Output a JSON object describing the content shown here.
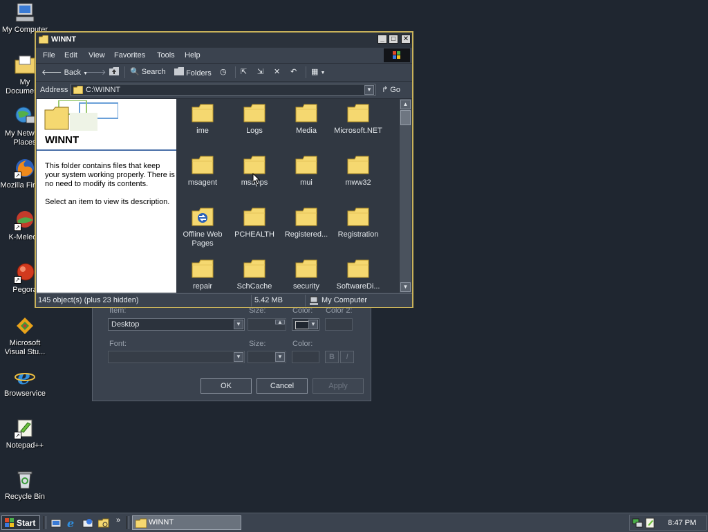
{
  "desktop": {
    "icons": [
      {
        "label": "My Computer",
        "icon": "my-computer-icon"
      },
      {
        "label": "My Documents",
        "icon": "my-documents-icon"
      },
      {
        "label": "My Network Places",
        "icon": "network-places-icon"
      },
      {
        "label": "Mozilla Firefox",
        "icon": "firefox-icon"
      },
      {
        "label": "K-Meleon",
        "icon": "kmeleon-icon"
      },
      {
        "label": "Pegora",
        "icon": "pegora-icon"
      },
      {
        "label": "Microsoft Visual Stu...",
        "icon": "visual-studio-icon"
      },
      {
        "label": "Browservice",
        "icon": "browservice-icon"
      },
      {
        "label": "Notepad++",
        "icon": "notepadpp-icon"
      },
      {
        "label": "Recycle Bin",
        "icon": "recycle-bin-icon"
      }
    ]
  },
  "background_dialog": {
    "item_label": "Item:",
    "item_value": "Desktop",
    "size_label": "Size:",
    "color_label": "Color:",
    "color2_label": "Color 2:",
    "font_label": "Font:",
    "font_size_label": "Size:",
    "font_color_label": "Color:",
    "bold_label": "B",
    "italic_label": "I",
    "ok_label": "OK",
    "cancel_label": "Cancel",
    "apply_label": "Apply"
  },
  "window": {
    "title": "WINNT",
    "menu": [
      "File",
      "Edit",
      "View",
      "Favorites",
      "Tools",
      "Help"
    ],
    "toolbar": {
      "back_label": "Back",
      "search_label": "Search",
      "folders_label": "Folders"
    },
    "address": {
      "label": "Address",
      "value": "C:\\WINNT",
      "go_label": "Go"
    },
    "info_pane": {
      "title": "WINNT",
      "description": "This folder contains files that keep your system working properly. There is no need to modify its contents.",
      "hint": "Select an item to view its description."
    },
    "folders": [
      {
        "label": "ime"
      },
      {
        "label": "Logs"
      },
      {
        "label": "Media"
      },
      {
        "label": "Microsoft.NET"
      },
      {
        "label": "msagent"
      },
      {
        "label": "msapps"
      },
      {
        "label": "mui"
      },
      {
        "label": "mww32"
      },
      {
        "label": "Offline Web Pages",
        "special": true
      },
      {
        "label": "PCHEALTH"
      },
      {
        "label": "Registered..."
      },
      {
        "label": "Registration"
      },
      {
        "label": "repair"
      },
      {
        "label": "SchCache"
      },
      {
        "label": "security"
      },
      {
        "label": "SoftwareDi..."
      }
    ],
    "status": {
      "objects": "145 object(s) (plus 23 hidden)",
      "size": "5.42 MB",
      "zone": "My Computer"
    }
  },
  "taskbar": {
    "start_label": "Start",
    "task_label": "WINNT",
    "clock": "8:47 PM"
  },
  "colors": {
    "desktop": "#1f2630",
    "window_frame": "#c9b25a",
    "folder": "#f5d870"
  }
}
